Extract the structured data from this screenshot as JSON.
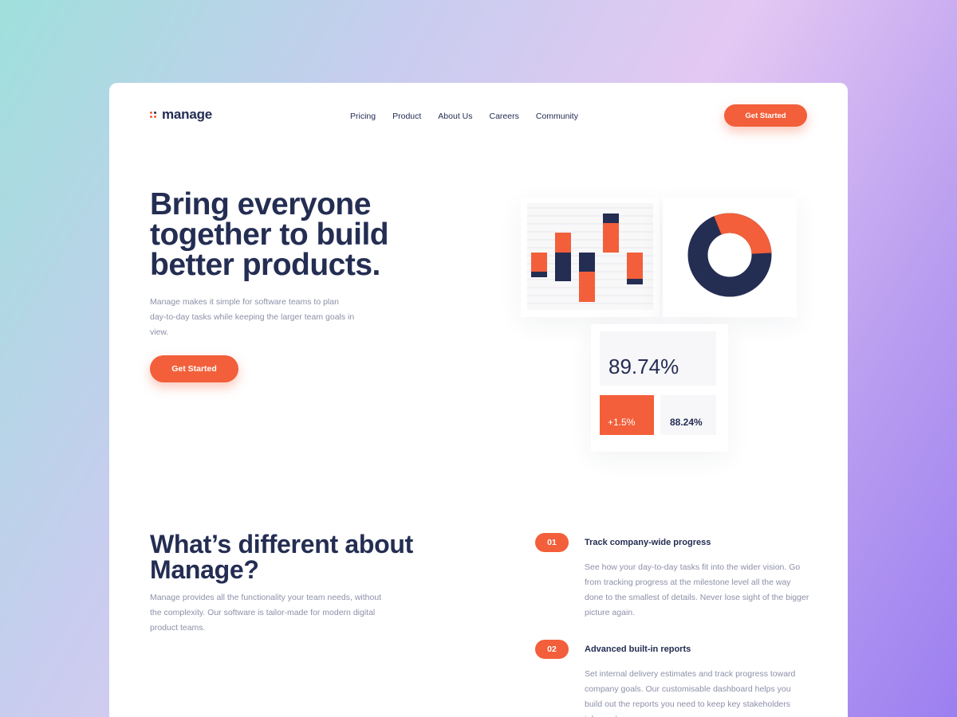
{
  "header": {
    "logo": "manage",
    "nav": [
      "Pricing",
      "Product",
      "About Us",
      "Careers",
      "Community"
    ],
    "cta": "Get Started"
  },
  "hero": {
    "title": "Bring everyone together to build better products.",
    "text": "Manage makes it simple for software teams to plan day-to-day tasks while keeping the larger team goals in view.",
    "cta": "Get Started"
  },
  "widgets": {
    "big_stat": "89.74%",
    "change_stat": "+1.5%",
    "small_stat": "88.24%"
  },
  "features_section": {
    "title": "What’s different about Manage?",
    "text": "Manage provides all the functionality your team needs, without the complexity. Our software is tailor-made for modern digital product teams.",
    "items": [
      {
        "number": "01",
        "title": "Track company-wide progress",
        "text": "See how your day-to-day tasks fit into the wider vision. Go from tracking progress at the milestone level all the way done to the smallest of details. Never lose sight of the bigger picture again."
      },
      {
        "number": "02",
        "title": "Advanced built-in reports",
        "text": "Set internal delivery estimates and track progress toward company goals. Our customisable dashboard helps you build out the reports you need to keep key stakeholders informed."
      }
    ]
  },
  "colors": {
    "accent": "#f25f3a",
    "navy": "#242d52",
    "muted": "#8d90a8"
  }
}
